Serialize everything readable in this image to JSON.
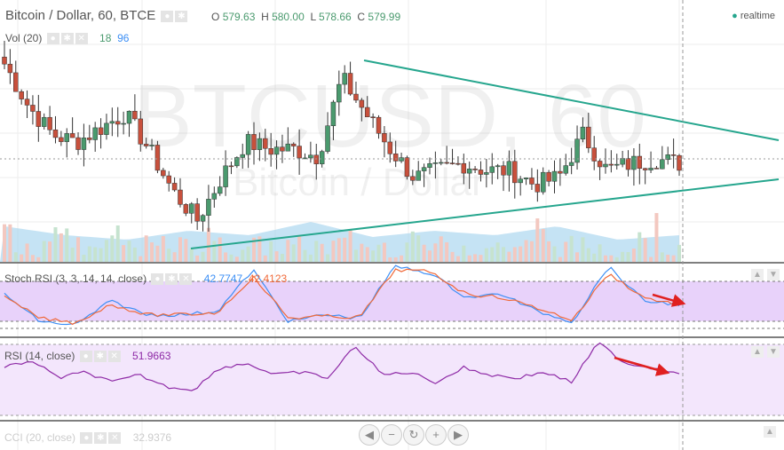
{
  "header": {
    "symbol": "Bitcoin / Dollar, 60, BTCE",
    "o_label": "O",
    "o": "579.63",
    "h_label": "H",
    "h": "580.00",
    "l_label": "L",
    "l": "578.66",
    "c_label": "C",
    "c": "579.99",
    "status": "realtime",
    "watermark": "BTCUSD, 60",
    "watermark_sub": "Bitcoin / Dollar"
  },
  "vol": {
    "label": "Vol (20)",
    "v1": "18",
    "v2": "96"
  },
  "stoch": {
    "label": "Stoch RSI (3, 3, 14, 14, close)",
    "k": "42.7747",
    "d": "42.4123"
  },
  "rsi": {
    "label": "RSI (14, close)",
    "value": "51.9663"
  },
  "cci": {
    "label": "CCI (20, close)",
    "value": "32.9376"
  },
  "nav": {
    "left": "◀",
    "minus": "−",
    "reset": "↻",
    "plus": "+",
    "right": "▶"
  },
  "colors": {
    "up": "#4a9a6e",
    "down": "#c8503c",
    "trend": "#26a68e",
    "k": "#3d8ff5",
    "d": "#f06a3a",
    "rsi": "#8e2aa6"
  },
  "chart_data": {
    "type": "candlestick",
    "title": "Bitcoin / Dollar, 60, BTCE",
    "price_anchors": [
      583,
      580,
      578,
      577.5,
      578.5,
      579.5,
      577,
      574,
      572,
      575,
      577.5,
      577,
      577,
      576.5,
      582,
      579.5,
      577,
      575,
      575.5,
      576,
      575.5,
      575.5,
      574.5,
      575,
      578,
      575.5,
      576,
      576.3,
      576
    ],
    "trendlines": [
      {
        "name": "upper",
        "from": [
          0.53,
          582
        ],
        "to": [
          1,
          576.5
        ]
      },
      {
        "name": "lower",
        "from": [
          0.24,
          571.5
        ],
        "to": [
          1,
          576.3
        ]
      }
    ],
    "stoch_k_anchors": [
      60,
      20,
      15,
      50,
      30,
      30,
      35,
      95,
      20,
      30,
      25,
      100,
      90,
      55,
      60,
      35,
      20,
      100,
      50,
      45
    ],
    "stoch_d_anchors": [
      55,
      25,
      18,
      45,
      30,
      30,
      33,
      85,
      25,
      28,
      26,
      95,
      92,
      60,
      55,
      40,
      22,
      90,
      55,
      44
    ],
    "rsi_anchors": [
      55,
      60,
      48,
      52,
      45,
      50,
      42,
      40,
      55,
      58,
      50,
      52,
      48,
      70,
      50,
      52,
      45,
      55,
      50,
      48,
      52,
      45,
      72,
      58,
      55,
      52
    ],
    "stoch_levels": [
      80,
      20
    ],
    "rsi_levels": [
      70,
      30
    ]
  }
}
